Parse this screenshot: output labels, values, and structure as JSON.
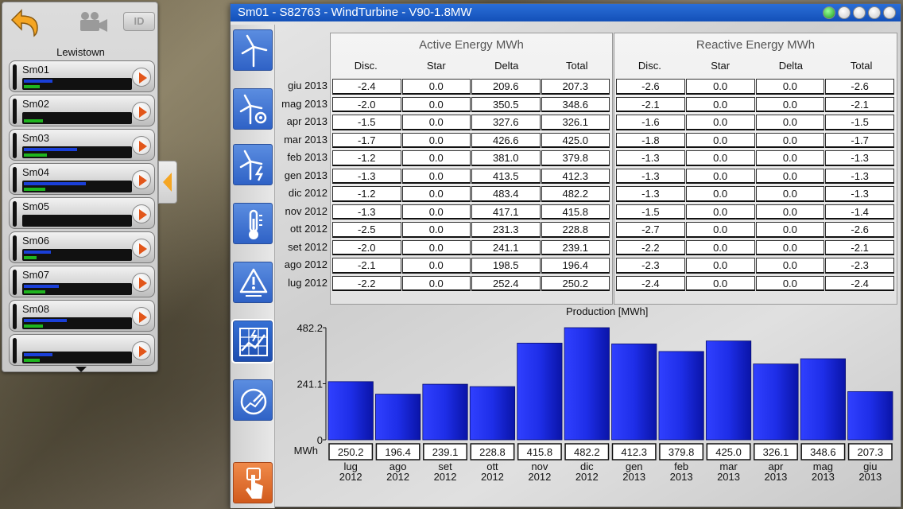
{
  "left_panel": {
    "site": "Lewistown",
    "id_button": "ID",
    "turbines": [
      {
        "name": "Sm01",
        "blue": 0.27,
        "green": 0.15
      },
      {
        "name": "Sm02",
        "blue": 0.0,
        "green": 0.18
      },
      {
        "name": "Sm03",
        "blue": 0.5,
        "green": 0.22
      },
      {
        "name": "Sm04",
        "blue": 0.58,
        "green": 0.2
      },
      {
        "name": "Sm05",
        "blue": 0.0,
        "green": 0.0
      },
      {
        "name": "Sm06",
        "blue": 0.25,
        "green": 0.12
      },
      {
        "name": "Sm07",
        "blue": 0.33,
        "green": 0.2
      },
      {
        "name": "Sm08",
        "blue": 0.4,
        "green": 0.18
      },
      {
        "name": "",
        "blue": 0.27,
        "green": 0.15
      }
    ]
  },
  "window": {
    "title": "Sm01 - S82763 - WindTurbine - V90-1.8MW"
  },
  "active": {
    "title": "Active Energy MWh",
    "columns": [
      "Disc.",
      "Star",
      "Delta",
      "Total"
    ],
    "rows": [
      [
        "-2.4",
        "0.0",
        "209.6",
        "207.3"
      ],
      [
        "-2.0",
        "0.0",
        "350.5",
        "348.6"
      ],
      [
        "-1.5",
        "0.0",
        "327.6",
        "326.1"
      ],
      [
        "-1.7",
        "0.0",
        "426.6",
        "425.0"
      ],
      [
        "-1.2",
        "0.0",
        "381.0",
        "379.8"
      ],
      [
        "-1.3",
        "0.0",
        "413.5",
        "412.3"
      ],
      [
        "-1.2",
        "0.0",
        "483.4",
        "482.2"
      ],
      [
        "-1.3",
        "0.0",
        "417.1",
        "415.8"
      ],
      [
        "-2.5",
        "0.0",
        "231.3",
        "228.8"
      ],
      [
        "-2.0",
        "0.0",
        "241.1",
        "239.1"
      ],
      [
        "-2.1",
        "0.0",
        "198.5",
        "196.4"
      ],
      [
        "-2.2",
        "0.0",
        "252.4",
        "250.2"
      ]
    ]
  },
  "reactive": {
    "title": "Reactive Energy MWh",
    "columns": [
      "Disc.",
      "Star",
      "Delta",
      "Total"
    ],
    "rows": [
      [
        "-2.6",
        "0.0",
        "0.0",
        "-2.6"
      ],
      [
        "-2.1",
        "0.0",
        "0.0",
        "-2.1"
      ],
      [
        "-1.6",
        "0.0",
        "0.0",
        "-1.5"
      ],
      [
        "-1.8",
        "0.0",
        "0.0",
        "-1.7"
      ],
      [
        "-1.3",
        "0.0",
        "0.0",
        "-1.3"
      ],
      [
        "-1.3",
        "0.0",
        "0.0",
        "-1.3"
      ],
      [
        "-1.3",
        "0.0",
        "0.0",
        "-1.3"
      ],
      [
        "-1.5",
        "0.0",
        "0.0",
        "-1.4"
      ],
      [
        "-2.7",
        "0.0",
        "0.0",
        "-2.6"
      ],
      [
        "-2.2",
        "0.0",
        "0.0",
        "-2.1"
      ],
      [
        "-2.3",
        "0.0",
        "0.0",
        "-2.3"
      ],
      [
        "-2.4",
        "0.0",
        "0.0",
        "-2.4"
      ]
    ]
  },
  "months": [
    "giu 2013",
    "mag 2013",
    "apr 2013",
    "mar 2013",
    "feb 2013",
    "gen 2013",
    "dic 2012",
    "nov 2012",
    "ott 2012",
    "set 2012",
    "ago 2012",
    "lug 2012"
  ],
  "colors": {
    "bar": "#1e2ee8",
    "title_bar": "#1a5cc8",
    "accent": "#e2561a"
  },
  "chart_data": {
    "type": "bar",
    "title": "Production [MWh]",
    "unit_label": "MWh",
    "categories": [
      [
        "lug",
        "2012"
      ],
      [
        "ago",
        "2012"
      ],
      [
        "set",
        "2012"
      ],
      [
        "ott",
        "2012"
      ],
      [
        "nov",
        "2012"
      ],
      [
        "dic",
        "2012"
      ],
      [
        "gen",
        "2013"
      ],
      [
        "feb",
        "2013"
      ],
      [
        "mar",
        "2013"
      ],
      [
        "apr",
        "2013"
      ],
      [
        "mag",
        "2013"
      ],
      [
        "giu",
        "2013"
      ]
    ],
    "values": [
      250.2,
      196.4,
      239.1,
      228.8,
      415.8,
      482.2,
      412.3,
      379.8,
      425.0,
      326.1,
      348.6,
      207.3
    ],
    "value_labels": [
      "250.2",
      "196.4",
      "239.1",
      "228.8",
      "415.8",
      "482.2",
      "412.3",
      "379.8",
      "425.0",
      "326.1",
      "348.6",
      "207.3"
    ],
    "ytick_labels": [
      "482.2",
      "241.1",
      "0"
    ],
    "yticks": [
      482.2,
      241.1,
      0
    ],
    "ylim": [
      0,
      482.2
    ],
    "grid": false
  }
}
